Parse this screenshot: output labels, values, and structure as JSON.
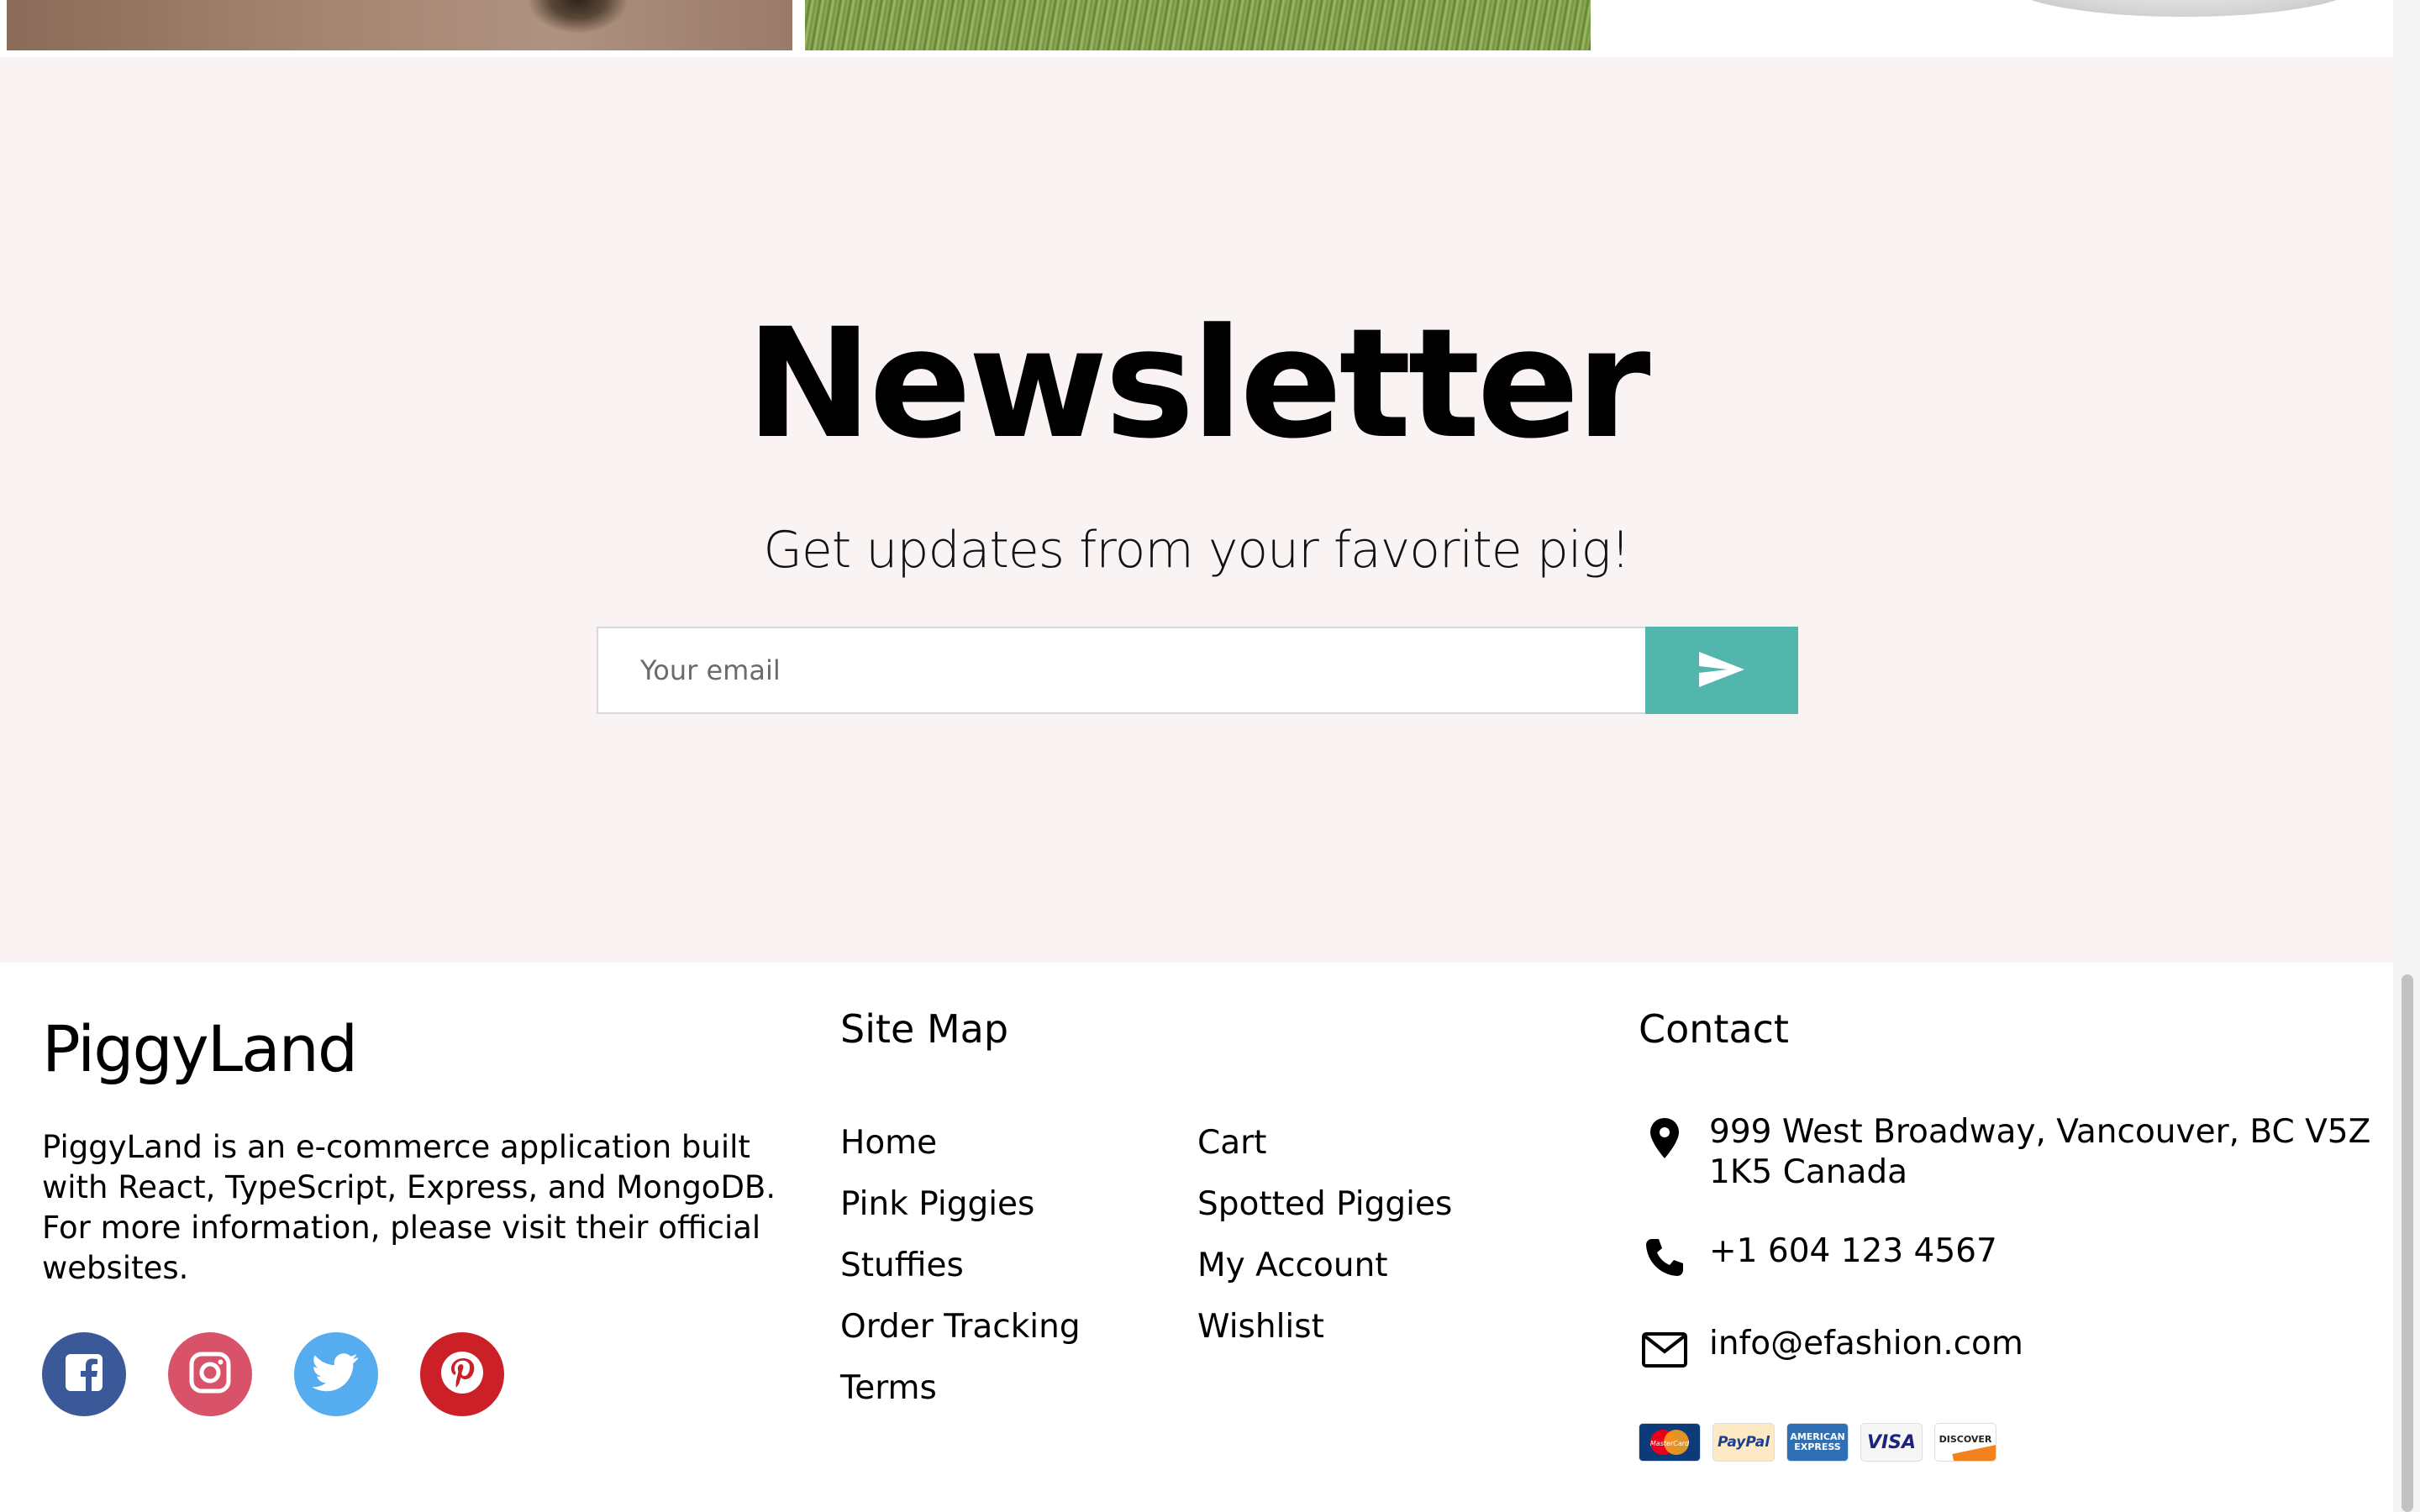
{
  "newsletter": {
    "title": "Newsletter",
    "subtitle": "Get updates from your favorite pig!",
    "email_placeholder": "Your email",
    "submit_icon": "send-icon",
    "background": "#f9f4f3",
    "button_color": "#52b6ad"
  },
  "footer": {
    "brand": "PiggyLand",
    "about": "PiggyLand is an e-commerce application built with React, TypeScript, Express, and MongoDB. For more information, please visit their official websites.",
    "socials": [
      {
        "name": "facebook-icon",
        "color": "#3b5998"
      },
      {
        "name": "instagram-icon",
        "color": "#d8536a"
      },
      {
        "name": "twitter-icon",
        "color": "#55acee"
      },
      {
        "name": "pinterest-icon",
        "color": "#cb2027"
      }
    ],
    "sitemap": {
      "title": "Site Map",
      "col1": [
        "Home",
        "Pink Piggies",
        "Stuffies",
        "Order Tracking",
        "Terms"
      ],
      "col2": [
        "Cart",
        "Spotted Piggies",
        "My Account",
        "Wishlist"
      ]
    },
    "contact": {
      "title": "Contact",
      "address": "999 West Broadway, Vancouver, BC V5Z 1K5 Canada",
      "phone": "+1 604 123 4567",
      "email": "info@efashion.com"
    },
    "payments": {
      "mastercard": "MasterCard",
      "paypal": "PayPal",
      "amex_1": "AMERICAN",
      "amex_2": "EXPRESS",
      "visa": "VISA",
      "discover": "DISCOVER"
    }
  }
}
